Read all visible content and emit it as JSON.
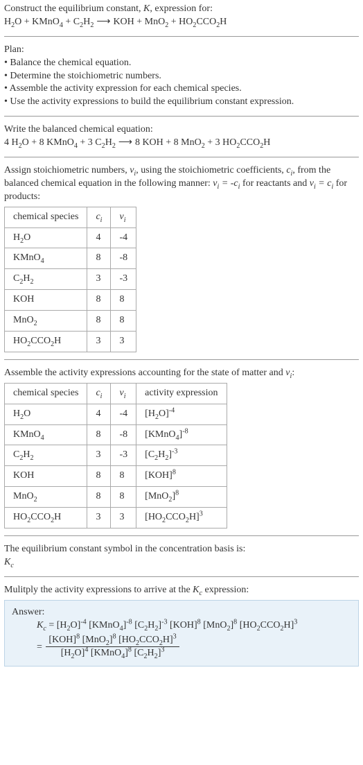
{
  "header": {
    "title_prefix": "Construct the equilibrium constant, ",
    "K_sym": "K",
    "title_suffix": ", expression for:",
    "reaction_text": "H₂O + KMnO₄ + C₂H₂ ⟶ KOH + MnO₂ + HO₂CCO₂H"
  },
  "plan": {
    "heading": "Plan:",
    "items": [
      "Balance the chemical equation.",
      "Determine the stoichiometric numbers.",
      "Assemble the activity expression for each chemical species.",
      "Use the activity expressions to build the equilibrium constant expression."
    ]
  },
  "balanced": {
    "heading": "Write the balanced chemical equation:",
    "equation_text": "4 H₂O + 8 KMnO₄ + 3 C₂H₂ ⟶ 8 KOH + 8 MnO₂ + 3 HO₂CCO₂H"
  },
  "stoich_intro": {
    "text1": "Assign stoichiometric numbers, ",
    "nu": "ν",
    "sub_i": "i",
    "text2": ", using the stoichiometric coefficients, ",
    "c": "c",
    "text3": ", from the balanced chemical equation in the following manner: ",
    "rel_reactants": "νᵢ = -cᵢ",
    "text4": " for reactants and ",
    "rel_products": "νᵢ = cᵢ",
    "text5": " for products:"
  },
  "table1": {
    "headers": {
      "species": "chemical species",
      "c": "cᵢ",
      "v": "νᵢ"
    },
    "rows": [
      {
        "species": "H₂O",
        "c": "4",
        "v": "-4"
      },
      {
        "species": "KMnO₄",
        "c": "8",
        "v": "-8"
      },
      {
        "species": "C₂H₂",
        "c": "3",
        "v": "-3"
      },
      {
        "species": "KOH",
        "c": "8",
        "v": "8"
      },
      {
        "species": "MnO₂",
        "c": "8",
        "v": "8"
      },
      {
        "species": "HO₂CCO₂H",
        "c": "3",
        "v": "3"
      }
    ]
  },
  "activity_intro": {
    "text1": "Assemble the activity expressions accounting for the state of matter and ",
    "nu": "ν",
    "sub_i": "i",
    "colon": ":"
  },
  "table2": {
    "headers": {
      "species": "chemical species",
      "c": "cᵢ",
      "v": "νᵢ",
      "act": "activity expression"
    },
    "rows": [
      {
        "species": "H₂O",
        "c": "4",
        "v": "-4",
        "base": "[H₂O]",
        "exp": "-4"
      },
      {
        "species": "KMnO₄",
        "c": "8",
        "v": "-8",
        "base": "[KMnO₄]",
        "exp": "-8"
      },
      {
        "species": "C₂H₂",
        "c": "3",
        "v": "-3",
        "base": "[C₂H₂]",
        "exp": "-3"
      },
      {
        "species": "KOH",
        "c": "8",
        "v": "8",
        "base": "[KOH]",
        "exp": "8"
      },
      {
        "species": "MnO₂",
        "c": "8",
        "v": "8",
        "base": "[MnO₂]",
        "exp": "8"
      },
      {
        "species": "HO₂CCO₂H",
        "c": "3",
        "v": "3",
        "base": "[HO₂CCO₂H]",
        "exp": "3"
      }
    ]
  },
  "conc_basis": {
    "text": "The equilibrium constant symbol in the concentration basis is:",
    "symbol_main": "K",
    "symbol_sub": "c"
  },
  "multiply": {
    "text1": "Mulitply the activity expressions to arrive at the ",
    "K": "K",
    "sub": "c",
    "text2": " expression:"
  },
  "answer": {
    "label": "Answer:",
    "lhs_K": "K",
    "lhs_sub": "c",
    "terms": [
      {
        "base": "[H₂O]",
        "exp": "-4"
      },
      {
        "base": "[KMnO₄]",
        "exp": "-8"
      },
      {
        "base": "[C₂H₂]",
        "exp": "-3"
      },
      {
        "base": "[KOH]",
        "exp": "8"
      },
      {
        "base": "[MnO₂]",
        "exp": "8"
      },
      {
        "base": "[HO₂CCO₂H]",
        "exp": "3"
      }
    ],
    "frac_num": [
      {
        "base": "[KOH]",
        "exp": "8"
      },
      {
        "base": "[MnO₂]",
        "exp": "8"
      },
      {
        "base": "[HO₂CCO₂H]",
        "exp": "3"
      }
    ],
    "frac_den": [
      {
        "base": "[H₂O]",
        "exp": "4"
      },
      {
        "base": "[KMnO₄]",
        "exp": "8"
      },
      {
        "base": "[C₂H₂]",
        "exp": "3"
      }
    ]
  }
}
